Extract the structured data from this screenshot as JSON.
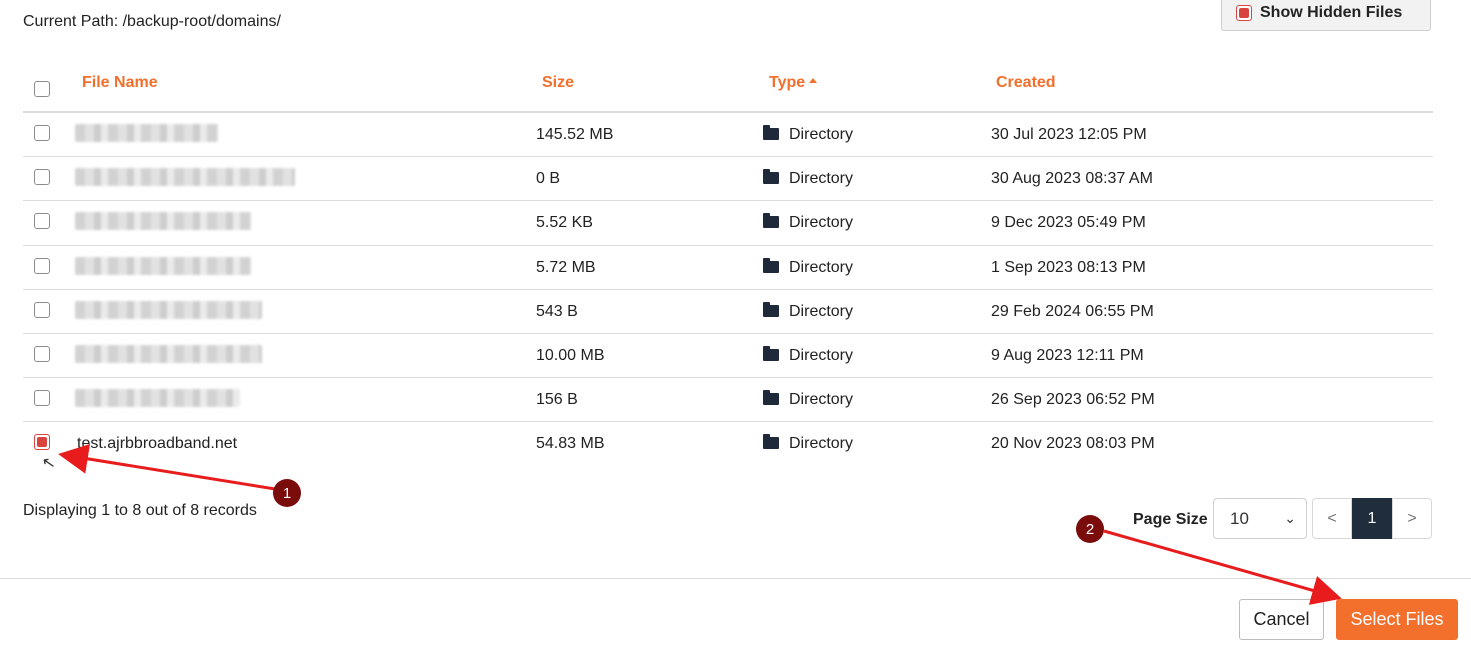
{
  "path_text": "Current Path: /backup-root/domains/",
  "hidden_files_label": "Show Hidden Files",
  "columns": {
    "name": "File Name",
    "size": "Size",
    "type": "Type",
    "created": "Created"
  },
  "rows": [
    {
      "name": "",
      "size": "145.52 MB",
      "type": "Directory",
      "created": "30 Jul 2023 12:05 PM"
    },
    {
      "name": "",
      "size": "0 B",
      "type": "Directory",
      "created": "30 Aug 2023 08:37 AM"
    },
    {
      "name": "",
      "size": "5.52 KB",
      "type": "Directory",
      "created": "9 Dec 2023 05:49 PM"
    },
    {
      "name": "",
      "size": "5.72 MB",
      "type": "Directory",
      "created": "1 Sep 2023 08:13 PM"
    },
    {
      "name": "",
      "size": "543 B",
      "type": "Directory",
      "created": "29 Feb 2024 06:55 PM"
    },
    {
      "name": "",
      "size": "10.00 MB",
      "type": "Directory",
      "created": "9 Aug 2023 12:11 PM"
    },
    {
      "name": "",
      "size": "156 B",
      "type": "Directory",
      "created": "26 Sep 2023 06:52 PM"
    },
    {
      "name": "test.ajrbbroadband.net",
      "size": "54.83 MB",
      "type": "Directory",
      "created": "20 Nov 2023 08:03 PM"
    }
  ],
  "records_text": "Displaying 1 to 8 out of 8 records",
  "page_size_label": "Page Size",
  "page_size_value": "10",
  "pagination": {
    "prev": "<",
    "current": "1",
    "next": ">"
  },
  "buttons": {
    "cancel": "Cancel",
    "select_files": "Select Files"
  },
  "annotations": {
    "step1": "1",
    "step2": "2"
  },
  "colors": {
    "accent": "#f26f2c",
    "checked": "#d9443f",
    "marker": "#7a0c0c",
    "arrow": "#e81c1c",
    "pager_active": "#1f2d3d"
  }
}
